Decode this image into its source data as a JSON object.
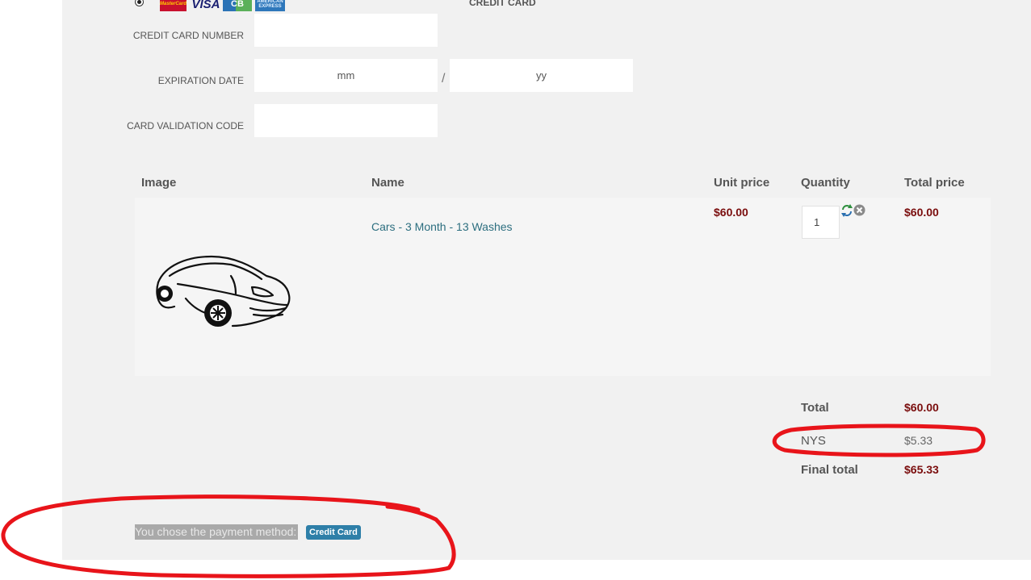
{
  "payment": {
    "method_title": "CREDIT CARD",
    "card_logos": {
      "mastercard": "MasterCard",
      "visa": "VISA",
      "cb": "CB",
      "amex": "AMERICAN EXPRESS"
    },
    "fields": {
      "card_number_label": "CREDIT CARD NUMBER",
      "card_number_value": "",
      "expiration_label": "EXPIRATION DATE",
      "exp_month_placeholder": "mm",
      "exp_separator": "/",
      "exp_year_placeholder": "yy",
      "cvc_label": "CARD VALIDATION CODE",
      "cvc_value": ""
    }
  },
  "cart": {
    "headers": {
      "image": "Image",
      "name": "Name",
      "unit_price": "Unit price",
      "quantity": "Quantity",
      "total_price": "Total price"
    },
    "items": [
      {
        "name": "Cars - 3 Month - 13 Washes",
        "unit_price": "$60.00",
        "quantity": "1",
        "total_price": "$60.00",
        "image_icon": "car-icon"
      }
    ],
    "summary": {
      "total_label": "Total",
      "total_value": "$60.00",
      "tax_label": "NYS",
      "tax_value": "$5.33",
      "final_label": "Final total",
      "final_value": "$65.33"
    }
  },
  "chosen_payment": {
    "text": "You chose the payment method:",
    "method_badge": "Credit Card"
  },
  "colors": {
    "price": "#7a0d0d",
    "link": "#2c6e7f",
    "badge": "#2e7fa8",
    "annotation": "#e8141a"
  }
}
